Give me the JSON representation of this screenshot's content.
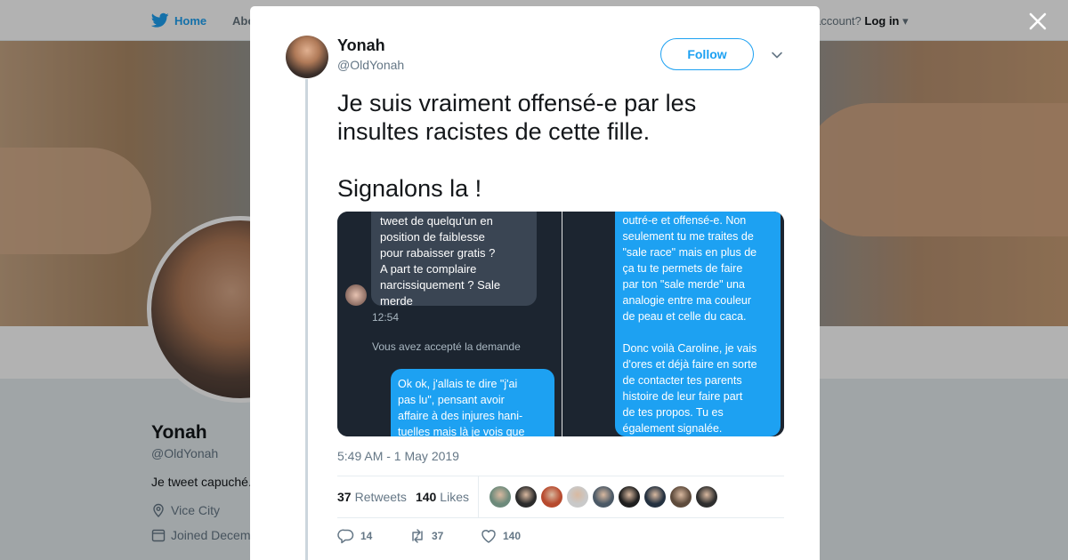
{
  "background": {
    "nav": {
      "home_label": "Home",
      "about_label": "Abo",
      "account_prefix": "account?",
      "login_label": "Log in"
    },
    "profile": {
      "name": "Yonah",
      "handle": "@OldYonah",
      "bio": "Je tweet capuché.",
      "location": "Vice City",
      "joined": "Joined Decem"
    }
  },
  "tweet": {
    "author_name": "Yonah",
    "author_handle": "@OldYonah",
    "follow_label": "Follow",
    "text": "Je suis vraiment offensé-e par les\ninsultes racistes de cette fille.\n\nSignalons la !",
    "media": {
      "left": {
        "gray_bubble": "tweet de quelqu'un en\nposition de faiblesse\npour rabaisser gratis ?\nA part te complaire\nnarcissiquement ? Sale\nmerde",
        "time": "12:54",
        "accepted": "Vous avez accepté la demande",
        "blue_bubble": "Ok ok, j'allais te dire \"j'ai\npas lu\", pensant avoir\naffaire à des injures hani-\ntuelles mais là je vois que"
      },
      "right": {
        "blue_bubble": "outré-e et offensé-e. Non\nseulement tu me traites de\n\"sale race\" mais en plus de\nça tu te permets de faire\npar ton \"sale merde\" una\nanalogie entre ma couleur\nde peau et celle du caca.\n\nDonc voilà Caroline, je vais\nd'ores et déjà faire en sorte\nde contacter tes parents\nhistoire de leur faire part\nde tes propos. Tu es\négalement signalée."
      }
    },
    "timestamp": "5:49 AM - 1 May 2019",
    "stats": {
      "retweets_count": "37",
      "retweets_label": "Retweets",
      "likes_count": "140",
      "likes_label": "Likes"
    },
    "likers_colors": [
      "#6d8a7b",
      "#2b2b2b",
      "#b74a2e",
      "#c9c9c9",
      "#4b5966",
      "#1f1f1f",
      "#243140",
      "#5e4b3c",
      "#2e2e2e"
    ],
    "actions": {
      "replies": "14",
      "retweets": "37",
      "likes": "140"
    }
  },
  "colors": {
    "accent": "#1da1f2",
    "text_secondary": "#657786"
  }
}
